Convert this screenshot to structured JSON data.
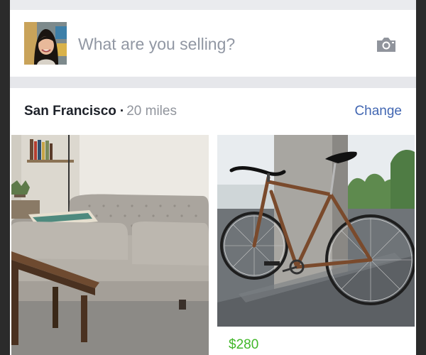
{
  "composer": {
    "placeholder": "What are you selling?",
    "avatar_icon": "profile-photo",
    "camera_icon": "camera-icon"
  },
  "location": {
    "city": "San Francisco",
    "separator": "·",
    "distance": "20 miles",
    "change_label": "Change"
  },
  "listings": [
    {
      "image": "gray-tufted-sofa-photo",
      "price": ""
    },
    {
      "image": "brown-bicycle-photo",
      "price": "$280"
    }
  ],
  "colors": {
    "link": "#4267b2",
    "price": "#42b72a",
    "placeholder": "#9197a3",
    "divider": "#e6e7eb"
  }
}
